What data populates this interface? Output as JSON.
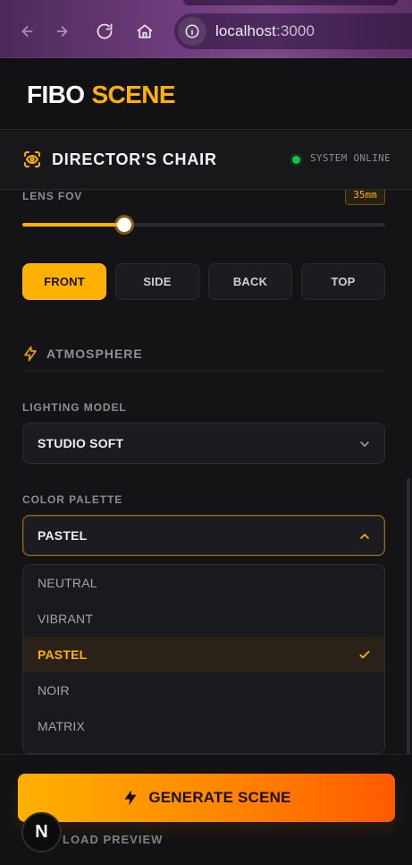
{
  "browser": {
    "url_host": "localhost",
    "url_port": ":3000",
    "nav": {
      "back_icon": "arrow-left-icon",
      "forward_icon": "arrow-right-icon",
      "reload_icon": "reload-icon",
      "home_icon": "home-icon",
      "info_icon": "info-icon"
    }
  },
  "brand": {
    "part1": "FIBO",
    "part2": "SCENE",
    "colors": {
      "accent": "#ffb100"
    }
  },
  "section": {
    "title": "DIRECTOR'S CHAIR",
    "status": "SYSTEM ONLINE",
    "icon": "eye-scan-icon"
  },
  "camera": {
    "lens_fov_label": "LENS FOV",
    "lens_fov_value": "35mm",
    "lens_fov_slider_fraction": 0.28,
    "views": [
      {
        "label": "FRONT",
        "active": true
      },
      {
        "label": "SIDE",
        "active": false
      },
      {
        "label": "BACK",
        "active": false
      },
      {
        "label": "TOP",
        "active": false
      }
    ]
  },
  "atmosphere": {
    "title": "ATMOSPHERE",
    "icon": "lightning-icon",
    "lighting_model_label": "LIGHTING MODEL",
    "lighting_model_value": "STUDIO SOFT",
    "color_palette_label": "COLOR PALETTE",
    "color_palette_value": "PASTEL",
    "palette_options": [
      {
        "label": "NEUTRAL",
        "selected": false
      },
      {
        "label": "VIBRANT",
        "selected": false
      },
      {
        "label": "PASTEL",
        "selected": true
      },
      {
        "label": "NOIR",
        "selected": false
      },
      {
        "label": "MATRIX",
        "selected": false
      }
    ]
  },
  "actions": {
    "generate_label": "GENERATE SCENE",
    "download_label": "LOAD PREVIEW",
    "badge_letter": "N"
  }
}
